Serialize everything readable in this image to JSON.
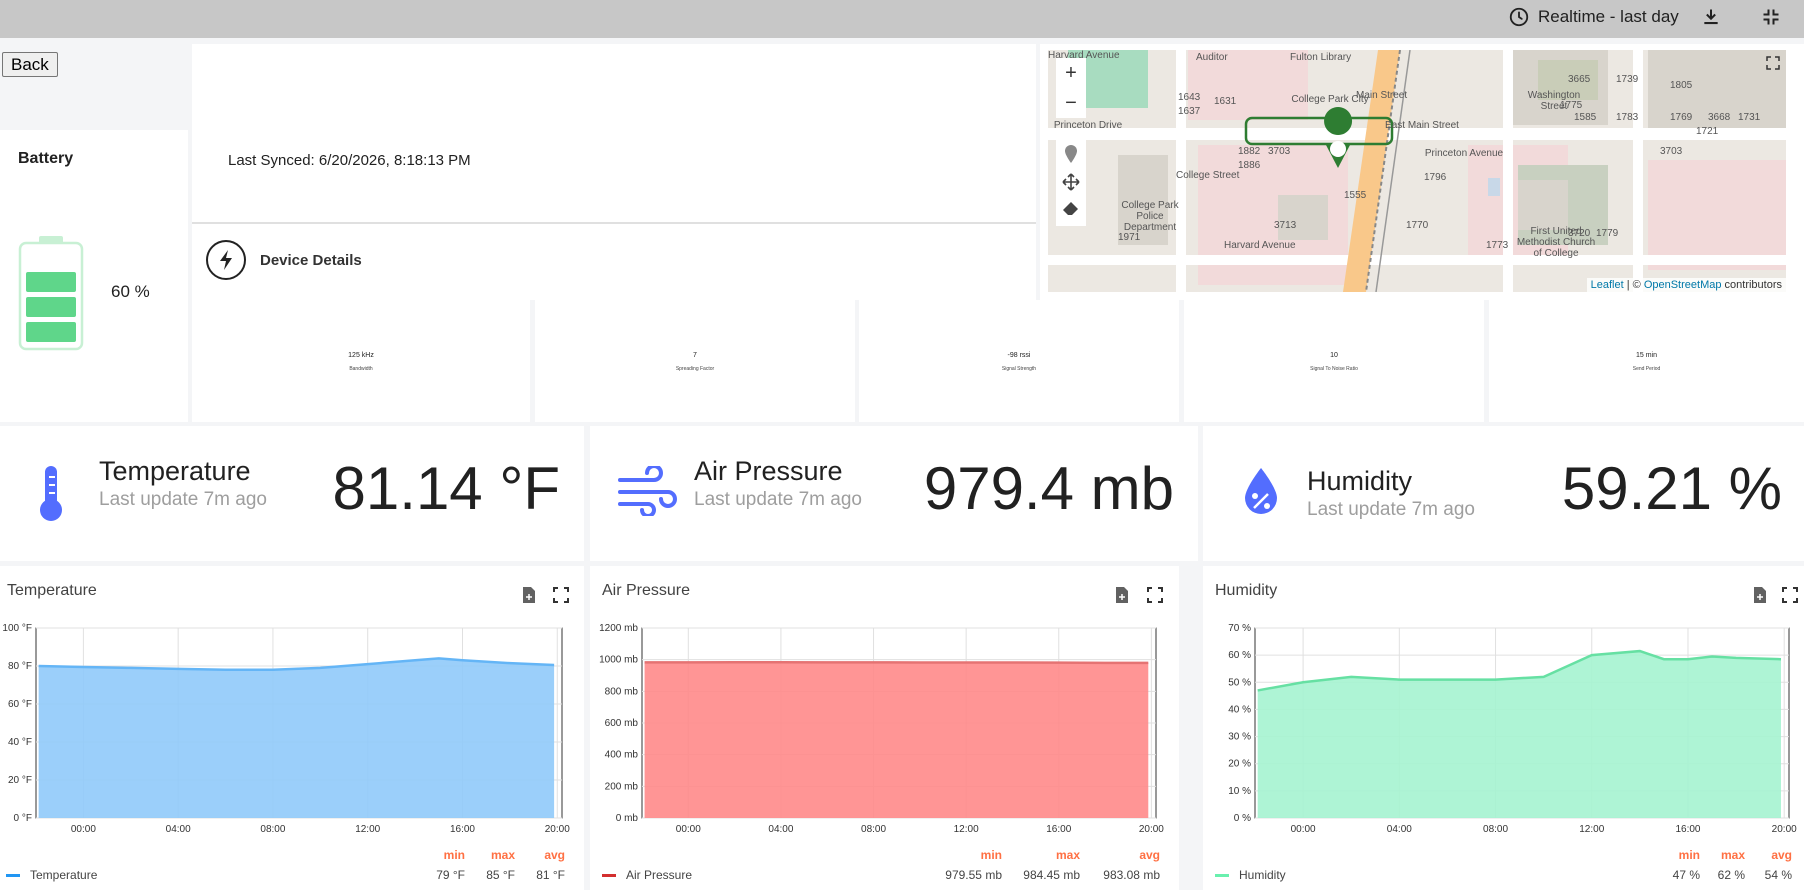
{
  "toolbar": {
    "time_range": "Realtime - last day",
    "icons": [
      "clock-icon",
      "download-icon",
      "exit-fullscreen-icon"
    ]
  },
  "back_button": "Back",
  "battery": {
    "title": "Battery",
    "percent_label": "60 %",
    "level": 0.6
  },
  "sync": {
    "last_synced": "Last Synced: 6/20/2026, 8:18:13 PM"
  },
  "device_details": {
    "label": "Device Details"
  },
  "map": {
    "zoom_in": "+",
    "zoom_out": "−",
    "labels": [
      "Auditor",
      "Fulton Library",
      "College Park City",
      "1643",
      "1637",
      "1631",
      "Princeton Drive",
      "1882",
      "3703",
      "1886",
      "College Park Police Department",
      "College Street",
      "1555",
      "3713",
      "1971",
      "Harvard Avenue",
      "Main Street",
      "East Main Street",
      "Washington Street",
      "3665",
      "1739",
      "1775",
      "1585",
      "1783",
      "1805",
      "1769",
      "3668",
      "1731",
      "1721",
      "Princeton Avenue",
      "1796",
      "3703",
      "1770",
      "First United Methodist Church of College",
      "3720",
      "1779",
      "1773",
      "Harvard Avenue"
    ],
    "attribution_leaflet": "Leaflet",
    "attribution_sep": " | © ",
    "attribution_osm": "OpenStreetMap",
    "attribution_tail": " contributors"
  },
  "stats": [
    {
      "value": "125 kHz",
      "label": "Bandwidth"
    },
    {
      "value": "7",
      "label": "Spreading Factor"
    },
    {
      "value": "-98 rssi",
      "label": "Signal Strength"
    },
    {
      "value": "10",
      "label": "Signal To Noise Ratio"
    },
    {
      "value": "15 min",
      "label": "Send Period"
    }
  ],
  "metrics": [
    {
      "title": "Temperature",
      "subtitle": "Last update 7m ago",
      "value": "81.14 °F",
      "icon": "thermometer-icon"
    },
    {
      "title": "Air Pressure",
      "subtitle": "Last update 7m ago",
      "value": "979.4 mb",
      "icon": "wind-icon"
    },
    {
      "title": "Humidity",
      "subtitle": "Last update 7m ago",
      "value": "59.21 %",
      "icon": "humidity-drop-icon"
    }
  ],
  "chart_data": [
    {
      "type": "area",
      "title": "Temperature",
      "x": [
        "22:00",
        "00:00",
        "02:00",
        "04:00",
        "06:00",
        "08:00",
        "10:00",
        "12:00",
        "14:00",
        "15:00",
        "16:00",
        "18:00",
        "20:00"
      ],
      "xticks": [
        "00:00",
        "04:00",
        "08:00",
        "12:00",
        "16:00",
        "20:00"
      ],
      "yticks": [
        "0 °F",
        "20 °F",
        "40 °F",
        "60 °F",
        "80 °F",
        "100 °F"
      ],
      "ylim": [
        0,
        100
      ],
      "series": [
        {
          "name": "Temperature",
          "values": [
            80,
            79.5,
            79,
            78.5,
            78,
            78,
            79,
            81,
            83,
            84,
            83,
            81.5,
            80.5
          ]
        }
      ],
      "color": "#90caf9",
      "stats": {
        "min": "79 °F",
        "max": "85 °F",
        "avg": "81 °F"
      }
    },
    {
      "type": "area",
      "title": "Air Pressure",
      "x": [
        "22:00",
        "00:00",
        "02:00",
        "04:00",
        "06:00",
        "08:00",
        "10:00",
        "12:00",
        "14:00",
        "16:00",
        "18:00",
        "20:00"
      ],
      "xticks": [
        "00:00",
        "04:00",
        "08:00",
        "12:00",
        "16:00",
        "20:00"
      ],
      "yticks": [
        "0 mb",
        "200 mb",
        "400 mb",
        "600 mb",
        "800 mb",
        "1000 mb",
        "1200 mb"
      ],
      "ylim": [
        0,
        1200
      ],
      "series": [
        {
          "name": "Air Pressure",
          "values": [
            983,
            983,
            984,
            984,
            983,
            983,
            982,
            982,
            982,
            981,
            980,
            980
          ]
        }
      ],
      "color": "#ff8a8a",
      "stats": {
        "min": "979.55 mb",
        "max": "984.45 mb",
        "avg": "983.08 mb"
      }
    },
    {
      "type": "area",
      "title": "Humidity",
      "x": [
        "22:00",
        "00:00",
        "02:00",
        "04:00",
        "06:00",
        "08:00",
        "10:00",
        "11:00",
        "12:00",
        "14:00",
        "15:00",
        "16:00",
        "17:00",
        "18:00",
        "20:00"
      ],
      "xticks": [
        "00:00",
        "04:00",
        "08:00",
        "12:00",
        "16:00",
        "20:00"
      ],
      "yticks": [
        "0 %",
        "10 %",
        "20 %",
        "30 %",
        "40 %",
        "50 %",
        "60 %",
        "70 %"
      ],
      "ylim": [
        0,
        70
      ],
      "series": [
        {
          "name": "Humidity",
          "values": [
            47,
            50,
            52,
            51,
            51,
            51,
            52,
            56,
            60,
            61.5,
            58.5,
            58.5,
            59.5,
            59,
            58.5
          ]
        }
      ],
      "color": "#a5f3d0",
      "stats": {
        "min": "47 %",
        "max": "62 %",
        "avg": "54 %"
      }
    }
  ],
  "legend_headers": {
    "min": "min",
    "max": "max",
    "avg": "avg"
  }
}
